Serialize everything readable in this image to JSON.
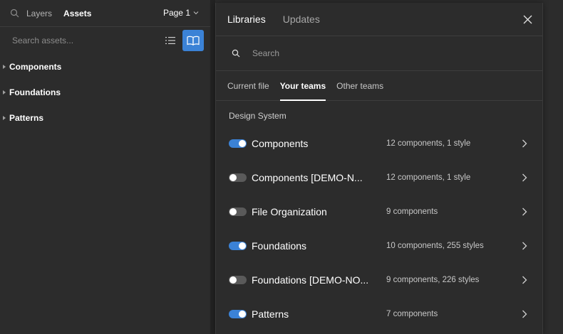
{
  "left_panel": {
    "tabs": [
      {
        "label": "Layers",
        "active": false
      },
      {
        "label": "Assets",
        "active": true
      }
    ],
    "page_select": "Page 1",
    "search_placeholder": "Search assets...",
    "groups": [
      "Components",
      "Foundations",
      "Patterns"
    ]
  },
  "modal": {
    "tabs": [
      {
        "label": "Libraries",
        "active": true
      },
      {
        "label": "Updates",
        "active": false
      }
    ],
    "search_placeholder": "Search",
    "subtabs": [
      {
        "label": "Current file",
        "active": false
      },
      {
        "label": "Your teams",
        "active": true
      },
      {
        "label": "Other teams",
        "active": false
      }
    ],
    "section_title": "Design System",
    "libraries": [
      {
        "name": "Components",
        "meta": "12 components, 1 style",
        "enabled": true
      },
      {
        "name": "Components [DEMO-N...",
        "meta": "12 components, 1 style",
        "enabled": false
      },
      {
        "name": "File Organization",
        "meta": "9 components",
        "enabled": false
      },
      {
        "name": "Foundations",
        "meta": "10 components, 255 styles",
        "enabled": true
      },
      {
        "name": "Foundations [DEMO-NO...",
        "meta": "9 components, 226 styles",
        "enabled": false
      },
      {
        "name": "Patterns",
        "meta": "7 components",
        "enabled": true
      }
    ]
  },
  "colors": {
    "accent": "#3b82d6",
    "background": "#2c2c2c",
    "toggle_off": "#5a5a5a"
  },
  "icons": {
    "left_search": "search-icon",
    "page_chevron": "chevron-down-icon",
    "list_view": "list-view-icon",
    "library": "book-open-icon",
    "close": "close-icon",
    "modal_search": "search-icon",
    "row": "chevron-right-icon"
  }
}
